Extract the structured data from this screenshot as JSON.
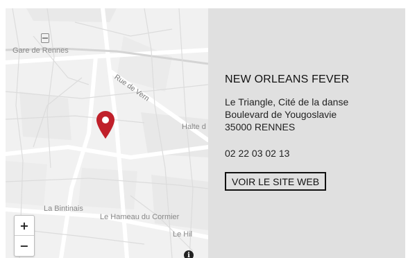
{
  "map": {
    "labels": {
      "station": "Gare de Rennes",
      "street": "Rue de Vern",
      "halt": "Halte d",
      "bintinais": "La Bintinais",
      "hameau": "Le Hameau du Cormier",
      "hil": "Le Hil"
    },
    "zoom_in": "+",
    "zoom_out": "−",
    "info": "i",
    "icons": {
      "station": "train-icon",
      "pin": "map-pin-icon"
    },
    "pin_color": "#c0202a"
  },
  "venue": {
    "name": "NEW ORLEANS FEVER",
    "address_lines": [
      "Le Triangle, Cité de la danse",
      "Boulevard de Yougoslavie",
      "35000 RENNES"
    ],
    "phone": "02 22 03 02 13",
    "website_button": "VOIR LE SITE WEB"
  },
  "colors": {
    "panel_bg": "#e0e0e0",
    "map_bg": "#f2f2f2"
  }
}
